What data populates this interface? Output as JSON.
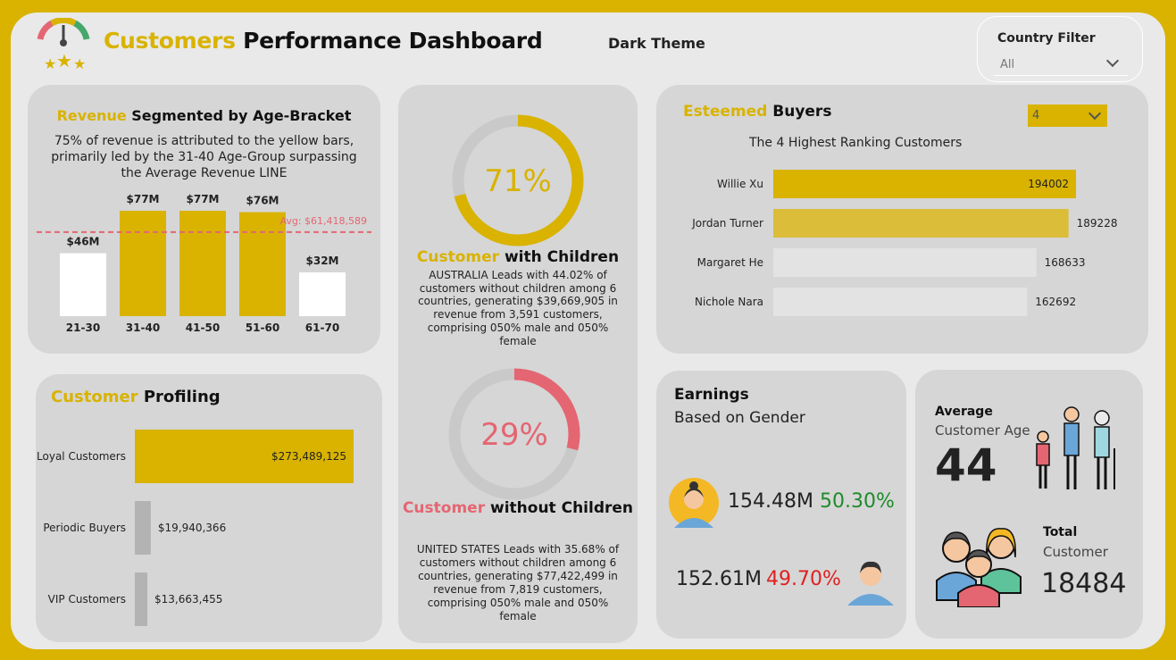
{
  "header": {
    "title_accent": "Customers",
    "title_rest": " Performance Dashboard",
    "theme_label": "Dark Theme"
  },
  "filter": {
    "label": "Country Filter",
    "value": "All"
  },
  "revenue": {
    "title_accent": "Revenue",
    "title_rest": " Segmented by Age-Bracket",
    "description": "75% of revenue is attributed to the yellow bars, primarily led by the 31-40 Age-Group surpassing the Average Revenue LINE"
  },
  "children": {
    "with_pct": "71%",
    "with_title_accent": "Customer",
    "with_title_rest": " with Children",
    "with_desc": "AUSTRALIA Leads with 44.02% of customers without children among 6 countries, generating $39,669,905 in revenue from 3,591 customers, comprising 050% male and 050% female",
    "without_pct": "29%",
    "without_title_accent": "Customer",
    "without_title_rest": " without Children",
    "without_desc": "UNITED STATES Leads with 35.68% of customers without children among 6 countries, generating $77,422,499 in revenue from 7,819 customers, comprising 050% male and 050% female"
  },
  "buyers": {
    "title_accent": "Esteemed",
    "title_rest": " Buyers",
    "dropdown_value": "4",
    "subtitle": "The 4 Highest Ranking Customers"
  },
  "profiling": {
    "title_accent": "Customer",
    "title_rest": " Profiling"
  },
  "earnings": {
    "title": "Earnings",
    "subtitle": "Based on Gender",
    "female_value": "154.48M",
    "female_pct": "50.30%",
    "male_value": "152.61M",
    "male_pct": "49.70%"
  },
  "stats": {
    "avg_label": "Average",
    "avg_sub": "Customer Age",
    "avg_value": "44",
    "total_label": "Total",
    "total_sub": "Customer",
    "total_value": "18484"
  },
  "colors": {
    "accent": "#d9b300",
    "red": "#e46672",
    "green": "#1e8c2a",
    "neg_red": "#e02020"
  },
  "chart_data": [
    {
      "type": "bar",
      "categories": [
        "21-30",
        "31-40",
        "41-50",
        "51-60",
        "61-70"
      ],
      "values": [
        46,
        77,
        77,
        76,
        32
      ],
      "labels": [
        "$46M",
        "$77M",
        "$77M",
        "$76M",
        "$32M"
      ],
      "highlight": [
        false,
        true,
        true,
        true,
        false
      ],
      "avg_label": "Avg: $61,418,589",
      "avg_value": 61.418589,
      "ylim": [
        0,
        80
      ]
    },
    {
      "type": "pie",
      "categories": [
        "Customer with Children",
        "Customer without Children"
      ],
      "values": [
        71,
        29
      ]
    },
    {
      "type": "bar",
      "orientation": "horizontal",
      "categories": [
        "Willie Xu",
        "Jordan Turner",
        "Margaret He",
        "Nichole Nara"
      ],
      "values": [
        194002,
        189228,
        168633,
        162692
      ],
      "xlim": [
        0,
        194002
      ]
    },
    {
      "type": "bar",
      "orientation": "horizontal",
      "categories": [
        "Loyal Customers",
        "Periodic Buyers",
        "VIP Customers"
      ],
      "values": [
        273489125,
        19940366,
        13663455
      ],
      "labels": [
        "$273,489,125",
        "$19,940,366",
        "$13,663,455"
      ],
      "xlim": [
        0,
        273489125
      ]
    }
  ]
}
